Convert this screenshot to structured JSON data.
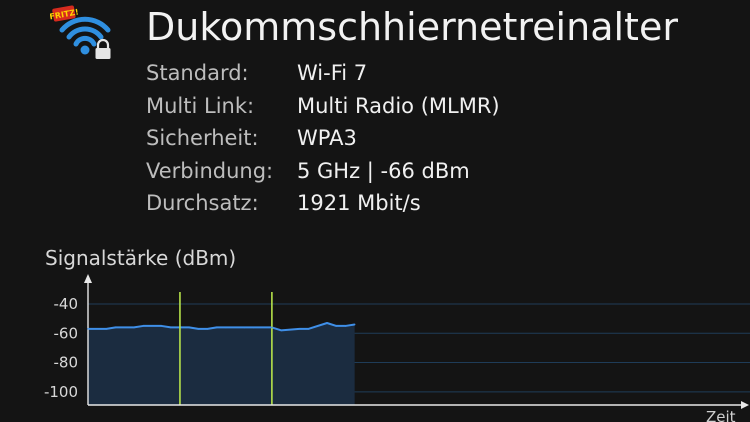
{
  "network": {
    "name": "Dukommschhiernetreinalter",
    "icon": "wifi-locked-icon",
    "badge_text": "FRITZ!"
  },
  "details": [
    {
      "label": "Standard:",
      "value": "Wi-Fi 7"
    },
    {
      "label": "Multi Link:",
      "value": "Multi Radio (MLMR)"
    },
    {
      "label": "Sicherheit:",
      "value": "WPA3"
    },
    {
      "label": "Verbindung:",
      "value": "5 GHz | -66 dBm"
    },
    {
      "label": "Durchsatz:",
      "value": "1921 Mbit/s"
    }
  ],
  "colors": {
    "background": "#141414",
    "wifi_blue": "#2f8fe0",
    "signal_line": "#3f8fe8",
    "signal_fill": "#1b2c40",
    "marker": "#b6e24a",
    "grid": "#1f3c58"
  },
  "chart_data": {
    "type": "area",
    "title": "Signalstärke (dBm)",
    "xlabel": "Zeit",
    "ylabel": "Signalstärke (dBm)",
    "yticks": [
      -40,
      -60,
      -80,
      -100
    ],
    "ylim": [
      -109,
      -25
    ],
    "x": [
      0,
      2,
      3,
      5,
      6,
      8,
      9,
      11,
      12,
      13,
      14,
      15,
      17,
      18,
      20,
      21,
      23,
      24,
      26,
      27,
      28,
      29
    ],
    "values": [
      -57,
      -57,
      -56,
      -56,
      -55,
      -55,
      -56,
      -56,
      -57,
      -57,
      -56,
      -56,
      -56,
      -56,
      -56,
      -58,
      -57,
      -57,
      -53,
      -55,
      -55,
      -54
    ],
    "xlim": [
      0,
      72
    ],
    "markers": [
      10,
      20
    ]
  }
}
